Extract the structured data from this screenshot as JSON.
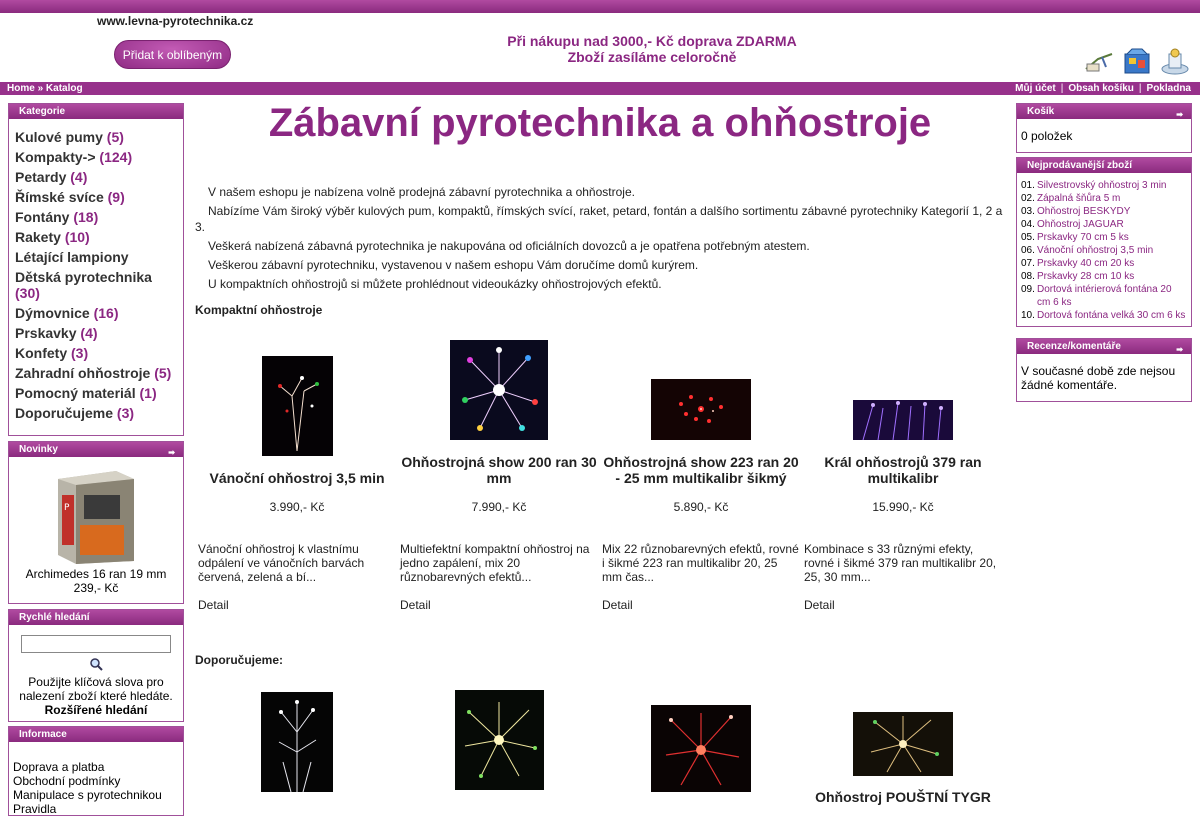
{
  "header": {
    "site_url": "www.levna-pyrotechnika.cz",
    "favorite_button": "Přidat k oblíbeným",
    "promo_line1": "Při nákupu nad 3000,- Kč doprava ZDARMA",
    "promo_line2": "Zboží zasíláme celoročně",
    "icons": [
      "account-icon",
      "cart-icon",
      "checkout-icon"
    ]
  },
  "nav": {
    "home": "Home",
    "sep": "»",
    "catalog": "Katalog",
    "my_account": "Můj účet",
    "cart_contents": "Obsah košíku",
    "checkout": "Pokladna",
    "divider": "|"
  },
  "categories": {
    "title": "Kategorie",
    "items": [
      {
        "label": "Kulové pumy",
        "count": "(5)"
      },
      {
        "label": "Kompakty->",
        "count": "(124)"
      },
      {
        "label": "Petardy",
        "count": "(4)"
      },
      {
        "label": "Římské svíce",
        "count": "(9)"
      },
      {
        "label": "Fontány",
        "count": "(18)"
      },
      {
        "label": "Rakety",
        "count": "(10)"
      },
      {
        "label": "Létající lampiony",
        "count": ""
      },
      {
        "label": "Dětská pyrotechnika",
        "count": "(30)"
      },
      {
        "label": "Dýmovnice",
        "count": "(16)"
      },
      {
        "label": "Prskavky",
        "count": "(4)"
      },
      {
        "label": "Konfety",
        "count": "(3)"
      },
      {
        "label": "Zahradní ohňostroje",
        "count": "(5)"
      },
      {
        "label": "Pomocný materiál",
        "count": "(1)"
      },
      {
        "label": "Doporučujeme",
        "count": "(3)"
      }
    ]
  },
  "news": {
    "title": "Novinky",
    "product_name": "Archimedes 16 ran 19 mm",
    "product_price": "239,- Kč"
  },
  "quick_search": {
    "title": "Rychlé hledání",
    "hint": "Použijte klíčová slova pro nalezení zboží které hledáte.",
    "advanced": "Rozšířené hledání"
  },
  "info": {
    "title": "Informace",
    "items": [
      "Doprava a platba",
      "Obchodní podmínky",
      "Manipulace s pyrotechnikou",
      "Pravidla"
    ]
  },
  "main": {
    "title": "Zábavní pyrotechnika a ohňostroje",
    "intro": [
      "V našem eshopu je nabízena volně prodejná zábavní pyrotechnika a ohňostroje.",
      "Nabízíme Vám široký výběr kulových pum, kompaktů, římských svící, raket, petard, fontán a dalšího sortimentu zábavné pyrotechniky Kategorií 1, 2 a 3.",
      "Veškerá nabízená zábavná pyrotechnika je nakupována od oficiálních dovozců a je opatřena potřebným atestem.",
      "Veškerou zábavní pyrotechniku, vystavenou v našem eshopu Vám doručíme domů kurýrem.",
      "U kompaktních ohňostrojů si můžete prohlédnout videoukázky ohňostrojových efektů."
    ],
    "compact_title": "Kompaktní ohňostroje",
    "recommended_title": "Doporučujeme:",
    "detail_label": "Detail",
    "products": [
      {
        "name": "Vánoční ohňostroj 3,5 min",
        "price": "3.990,- Kč",
        "desc": "Vánoční ohňostroj k vlastnímu odpálení ve vánočních barvách červená, zelená a bí..."
      },
      {
        "name": "Ohňostrojná show 200 ran 30 mm",
        "price": "7.990,- Kč",
        "desc": "Multiefektní kompaktní ohňostroj na jedno zapálení, mix 20 různobarevných efektů..."
      },
      {
        "name": "Ohňostrojná show 223 ran 20 - 25 mm multikalibr šikmý",
        "price": "5.890,- Kč",
        "desc": "Mix 22 různobarevných efektů, rovné i šikmé 223 ran multikalibr 20, 25 mm čas..."
      },
      {
        "name": "Král ohňostrojů 379 ran multikalibr",
        "price": "15.990,- Kč",
        "desc": "Kombinace s 33 různými efekty, rovné i šikmé 379 ran multikalibr 20, 25, 30 mm..."
      }
    ],
    "recommended_partial_name": "Ohňostroj POUŠTNÍ TYGR"
  },
  "cart": {
    "title": "Košík",
    "items": "0 položek"
  },
  "bestsellers": {
    "title": "Nejprodávanější zboží",
    "items": [
      {
        "n": "01.",
        "t": "Silvestrovský ohňostroj 3 min"
      },
      {
        "n": "02.",
        "t": "Zápalná šňůra 5 m"
      },
      {
        "n": "03.",
        "t": "Ohňostroj BESKYDY"
      },
      {
        "n": "04.",
        "t": "Ohňostroj JAGUAR"
      },
      {
        "n": "05.",
        "t": "Prskavky 70 cm 5 ks"
      },
      {
        "n": "06.",
        "t": "Vánoční ohňostroj 3,5 min"
      },
      {
        "n": "07.",
        "t": "Prskavky 40 cm 20 ks"
      },
      {
        "n": "08.",
        "t": "Prskavky 28 cm 10 ks"
      },
      {
        "n": "09.",
        "t": "Dortová intérierová fontána 20 cm 6 ks"
      },
      {
        "n": "10.",
        "t": "Dortová fontána velká 30 cm 6 ks"
      }
    ]
  },
  "reviews": {
    "title": "Recenze/komentáře",
    "text": "V současné době zde nejsou žádné komentáře."
  },
  "colors": {
    "brand": "#8b2782",
    "bar": "#97318b"
  }
}
